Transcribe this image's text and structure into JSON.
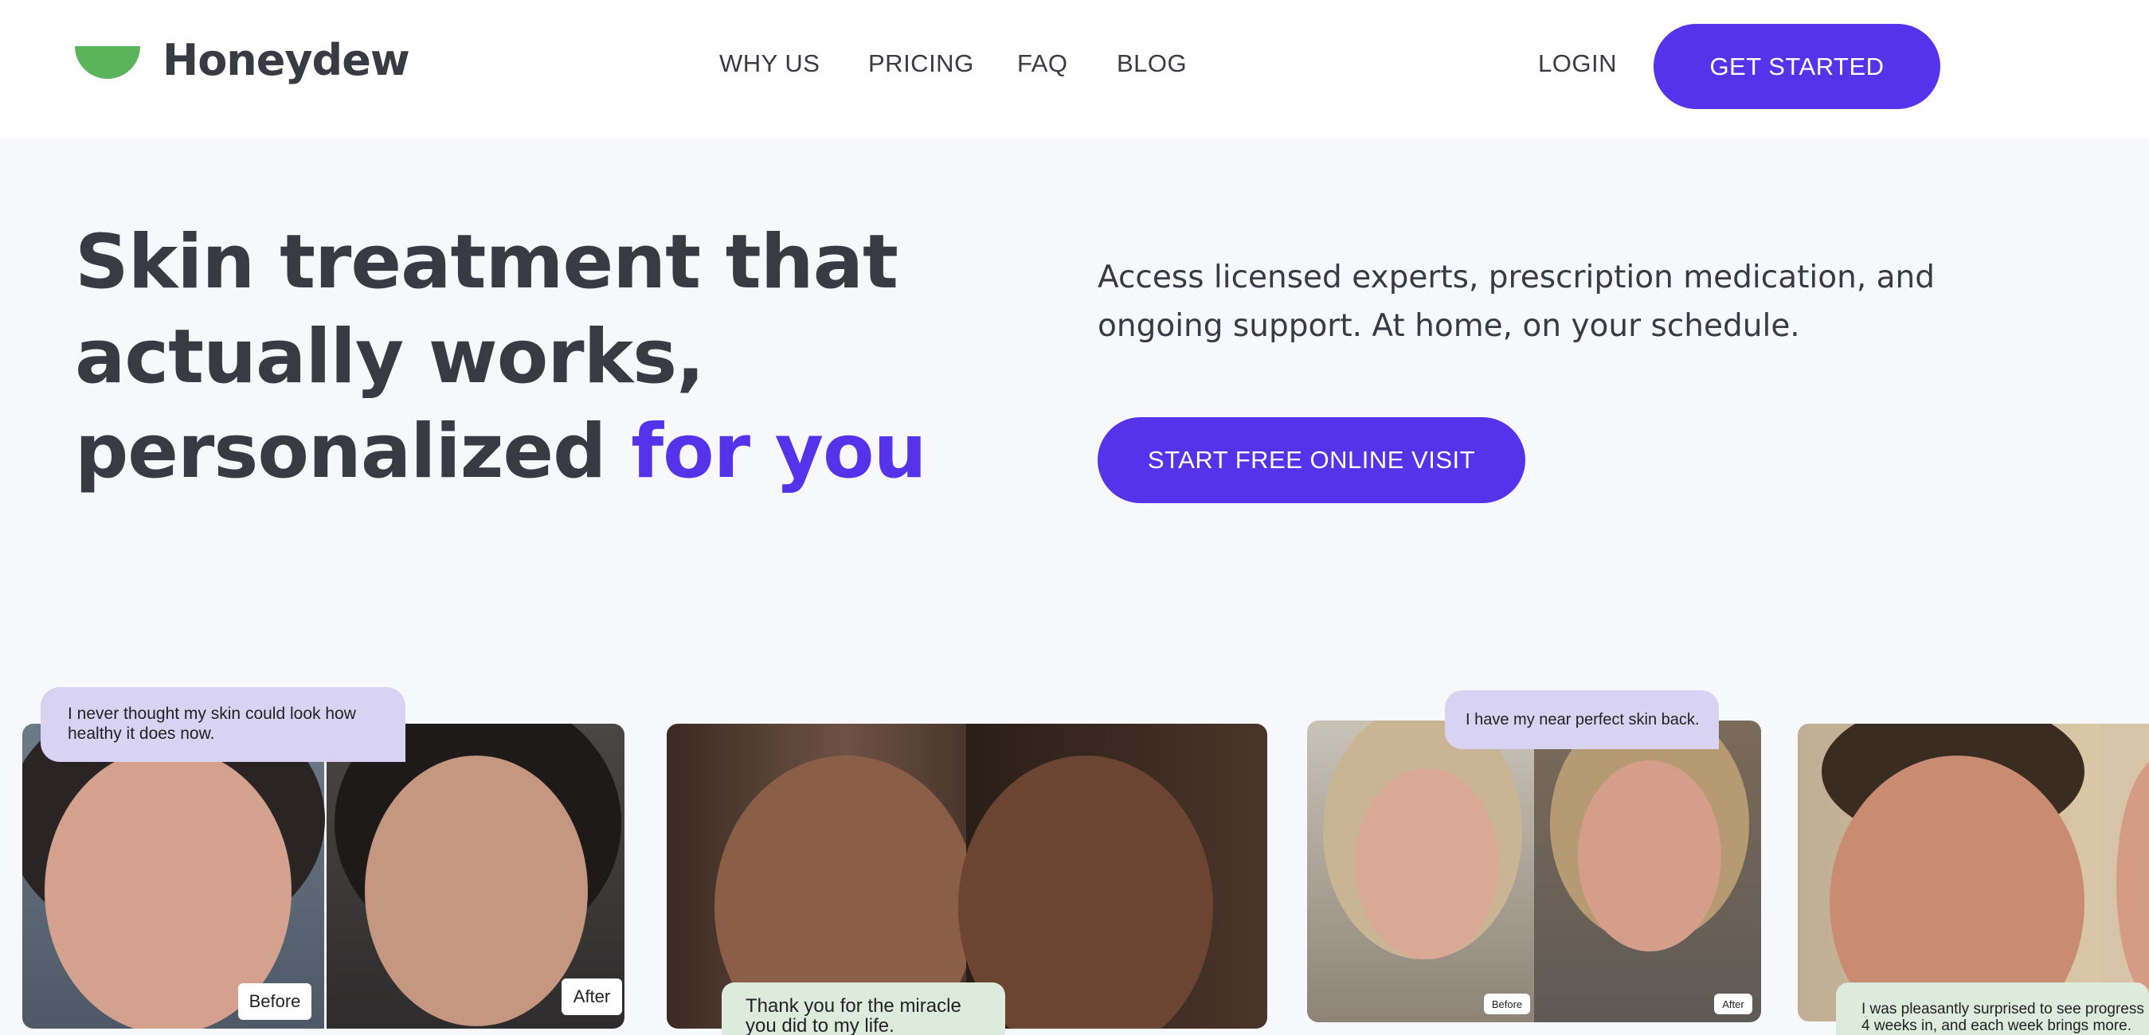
{
  "brand": {
    "name": "Honeydew",
    "logo_color": "#5bb35a",
    "accent_color": "#5533eb"
  },
  "nav": {
    "items": [
      "WHY US",
      "PRICING",
      "FAQ",
      "BLOG"
    ],
    "login": "LOGIN",
    "get_started": "GET STARTED"
  },
  "hero": {
    "title_line1": "Skin treatment that",
    "title_line2": "actually works,",
    "title_line3_plain": "personalized",
    "title_line3_accent": "for you",
    "description": "Access licensed experts, prescription medication, and ongoing support. At home, on your schedule.",
    "cta": "START FREE ONLINE VISIT"
  },
  "testimonials": [
    {
      "quote": "I never thought my skin could look how healthy it does now.",
      "before": "Before",
      "after": "After"
    },
    {
      "quote": "Thank you for the miracle you did to my life."
    },
    {
      "quote": "I have my near perfect skin back.",
      "before": "Before",
      "after": "After"
    },
    {
      "quote": "I was pleasantly surprised to see progress 4 weeks in, and each week brings more."
    }
  ]
}
